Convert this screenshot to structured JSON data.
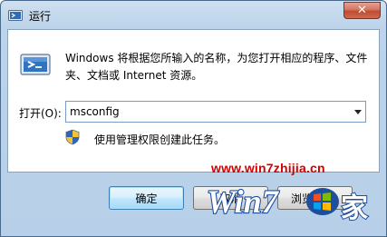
{
  "window": {
    "title": "运行",
    "close_glyph": "✕"
  },
  "description": "Windows 将根据您所输入的名称，为您打开相应的程序、文件夹、文档或 Internet 资源。",
  "open_field": {
    "label": "打开(O):",
    "value": "msconfig"
  },
  "admin_note": "使用管理权限创建此任务。",
  "buttons": {
    "ok": "确定",
    "cancel": "取消",
    "browse": "浏览(B)..."
  },
  "watermark": {
    "url": "www.win7zhijia.cn",
    "logo_text": "Win7",
    "logo_suffix": "家"
  },
  "colors": {
    "title_gradient": "#bcd3ea",
    "watermark_red": "#d10000",
    "logo_blue": "#1d4f9e"
  }
}
